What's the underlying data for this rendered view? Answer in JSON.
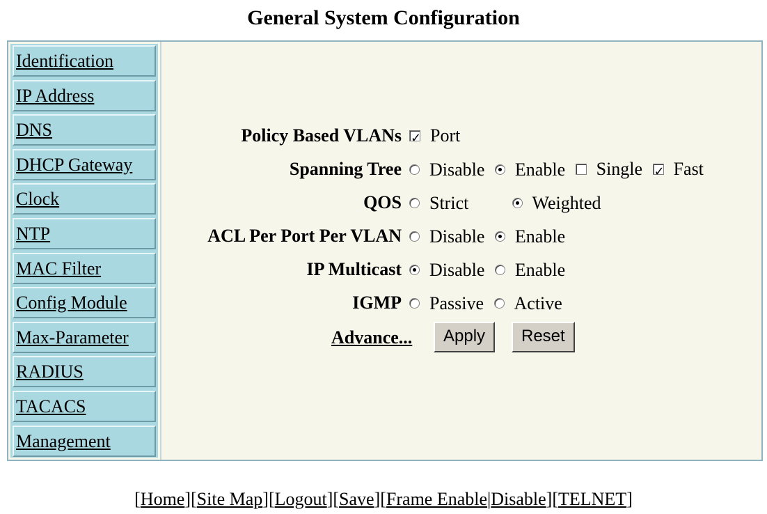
{
  "page": {
    "title": "General System Configuration"
  },
  "sidebar": {
    "items": [
      {
        "label": "Identification"
      },
      {
        "label": "IP Address"
      },
      {
        "label": "DNS"
      },
      {
        "label": "DHCP Gateway"
      },
      {
        "label": "Clock"
      },
      {
        "label": "NTP"
      },
      {
        "label": "MAC Filter"
      },
      {
        "label": "Config Module"
      },
      {
        "label": "Max-Parameter"
      },
      {
        "label": "RADIUS"
      },
      {
        "label": "TACACS"
      },
      {
        "label": "Management"
      }
    ]
  },
  "form": {
    "policy_vlans": {
      "label": "Policy Based VLANs",
      "options": [
        {
          "label": "Port",
          "checked": true
        }
      ]
    },
    "spanning_tree": {
      "label": "Spanning Tree",
      "options": [
        {
          "label": "Disable",
          "checked": false
        },
        {
          "label": "Enable",
          "checked": true
        },
        {
          "label": "Single",
          "checked": false
        },
        {
          "label": "Fast",
          "checked": true
        }
      ]
    },
    "qos": {
      "label": "QOS",
      "options": [
        {
          "label": "Strict",
          "checked": false
        },
        {
          "label": "Weighted",
          "checked": true
        }
      ]
    },
    "acl": {
      "label": "ACL Per Port Per VLAN",
      "options": [
        {
          "label": "Disable",
          "checked": false
        },
        {
          "label": "Enable",
          "checked": true
        }
      ]
    },
    "ip_multicast": {
      "label": "IP Multicast",
      "options": [
        {
          "label": "Disable",
          "checked": true
        },
        {
          "label": "Enable",
          "checked": false
        }
      ]
    },
    "igmp": {
      "label": "IGMP",
      "options": [
        {
          "label": "Passive",
          "checked": false
        },
        {
          "label": "Active",
          "checked": false
        }
      ]
    },
    "advance_label": "Advance...",
    "apply_label": "Apply",
    "reset_label": "Reset"
  },
  "footer": {
    "links": [
      {
        "label": "Home"
      },
      {
        "label": "Site Map"
      },
      {
        "label": "Logout"
      },
      {
        "label": "Save"
      },
      {
        "label": "Frame Enable"
      },
      {
        "label": "Disable"
      },
      {
        "label": "TELNET"
      }
    ]
  },
  "colors": {
    "sidebar_bg": "#a9d8e1",
    "content_bg": "#f6f6ea",
    "frame_border": "#8fb3bf",
    "button_bg": "#d4d0c8"
  }
}
